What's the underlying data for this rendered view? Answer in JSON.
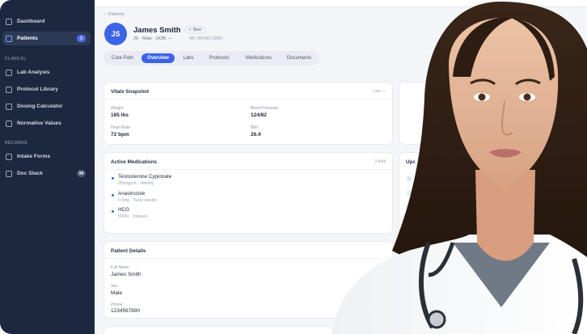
{
  "sidebar": {
    "items": [
      {
        "label": "Dashboard",
        "icon": "grid-icon"
      },
      {
        "label": "Patients",
        "icon": "users-icon",
        "badge": "3"
      },
      {
        "label": "Lab Analysis",
        "icon": "flask-icon"
      },
      {
        "label": "Protocol Library",
        "icon": "book-icon"
      },
      {
        "label": "Dosing Calculator",
        "icon": "calculator-icon"
      },
      {
        "label": "Normative Values",
        "icon": "chart-icon"
      },
      {
        "label": "Intake Forms",
        "icon": "form-icon"
      },
      {
        "label": "Doc Stack",
        "icon": "folder-icon",
        "badge": "99"
      }
    ],
    "section_clinical": "CLINICAL",
    "section_records": "RECORDS"
  },
  "breadcrumb": "Patients",
  "patient": {
    "initials": "JS",
    "name": "James Smith",
    "status": "New",
    "meta": "25 · Male · DOB: —",
    "mrn": "MR-382493-26891"
  },
  "tabs": [
    "Care Path",
    "Overview",
    "Labs",
    "Protocols",
    "Medications",
    "Documents"
  ],
  "active_tab": "Overview",
  "vitals": {
    "title": "Vitals Snapshot",
    "right": "Last —",
    "weight_label": "Weight",
    "weight": "185 lbs",
    "bp_label": "Blood Pressure",
    "bp": "124/82",
    "hr_label": "Heart Rate",
    "hr": "72 bpm",
    "bmi_label": "BMI",
    "bmi": "26.4"
  },
  "medications": {
    "title": "Active Medications",
    "right": "3 total",
    "items": [
      {
        "name": "Testosterone Cypionate",
        "sub": "200mg/mL · Weekly"
      },
      {
        "name": "Anastrozole",
        "sub": "0.5mg · Twice weekly"
      },
      {
        "name": "HCG",
        "sub": "500IU · 3x/week"
      }
    ]
  },
  "details": {
    "title": "Patient Details",
    "fullname_label": "Full Name",
    "fullname": "James Smith",
    "sex_label": "Sex",
    "sex": "Male",
    "phone_label": "Phone",
    "phone": "1234567890"
  },
  "side_card": {
    "title": "Upc"
  },
  "colors": {
    "accent": "#3d63e6",
    "sidebar": "#1c2740"
  }
}
